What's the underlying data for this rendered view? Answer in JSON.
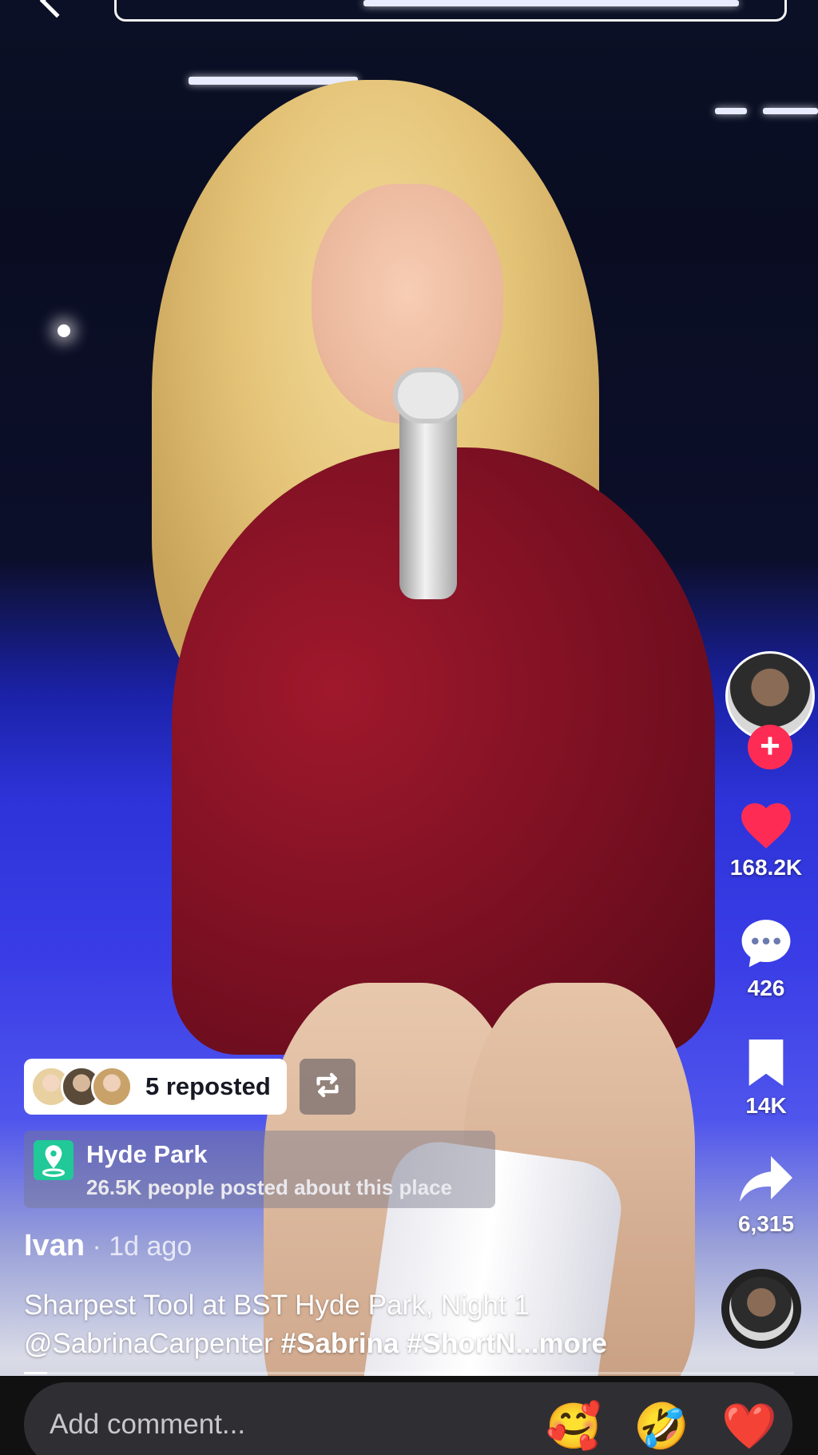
{
  "header": {
    "search_placeholder": ""
  },
  "actions": {
    "likes": "168.2K",
    "comments": "426",
    "saves": "14K",
    "shares": "6,315"
  },
  "repost": {
    "label": "5 reposted"
  },
  "location": {
    "name": "Hyde Park",
    "subtitle": "26.5K people posted about this place"
  },
  "post": {
    "author": "Ivan",
    "time": " · 1d ago",
    "caption_line1": "Sharpest Tool at BST Hyde Park, Night 1",
    "mention": "@SabrinaCarpenter",
    "hashtag1": "#Sabrina",
    "hashtag2": "#ShortN...",
    "more": "more"
  },
  "playback": {
    "progress_fraction": 0.03
  },
  "comment_bar": {
    "placeholder": "Add comment...",
    "emojis": [
      "🥰",
      "🤣",
      "❤️"
    ]
  },
  "colors": {
    "like_red": "#fe2c55",
    "location_green": "#20c997"
  }
}
